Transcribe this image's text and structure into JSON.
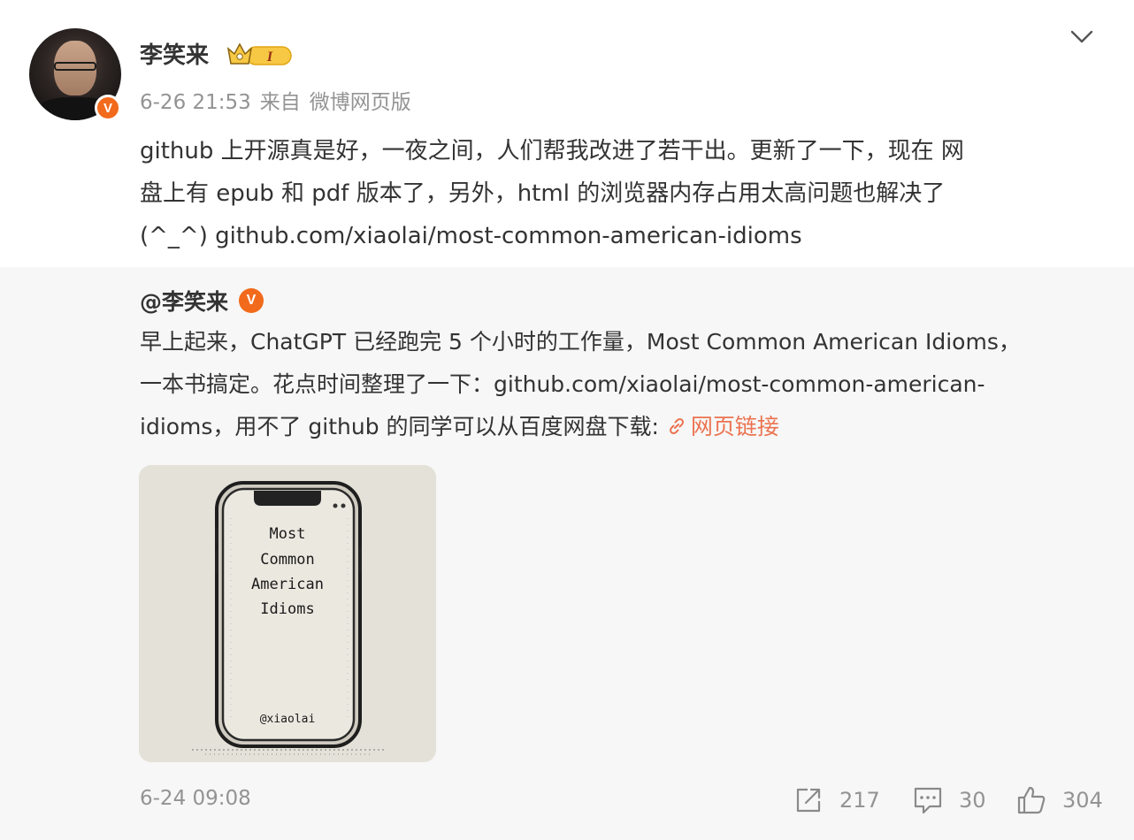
{
  "post": {
    "author": "李笑来",
    "author_verified_badge": "V",
    "vip_badge_text": "I",
    "time": "6-26 21:53",
    "source_prefix": "来自",
    "source": "微博网页版",
    "text_lines": [
      "github 上开源真是好，一夜之间，人们帮我改进了若干出。更新了一下，现在 网",
      "盘上有 epub 和 pdf 版本了，另外，html 的浏览器内存占用太高问题也解决了",
      "(^_^) github.com/xiaolai/most-common-american-idioms"
    ],
    "icons": {
      "avatar": "user-avatar",
      "more": "chevron-down-icon",
      "verified": "verified-v-icon",
      "vip": "crown-vip-icon"
    }
  },
  "repost": {
    "author": "@李笑来",
    "author_verified_badge": "V",
    "text_lines": [
      "早上起来，ChatGPT 已经跑完 5 个小时的工作量，Most Common American Idioms，",
      "一本书搞定。花点时间整理了一下：github.com/xiaolai/most-common-american-",
      "idioms，用不了 github 的同学可以从百度网盘下载: "
    ],
    "link_label": "网页链接",
    "image": {
      "title_lines": [
        "Most",
        "Common",
        "American",
        "Idioms"
      ],
      "handle": "@xiaolai"
    },
    "time": "6-24 09:08",
    "actions": {
      "repost_count": "217",
      "comment_count": "30",
      "like_count": "304"
    },
    "icons": {
      "link": "link-icon",
      "repost": "share-icon",
      "comment": "comment-icon",
      "like": "thumbs-up-icon"
    }
  },
  "colors": {
    "accent": "#eb7350",
    "badge": "#f26a1b",
    "muted": "#939393",
    "repost_bg": "#f7f7f7"
  }
}
